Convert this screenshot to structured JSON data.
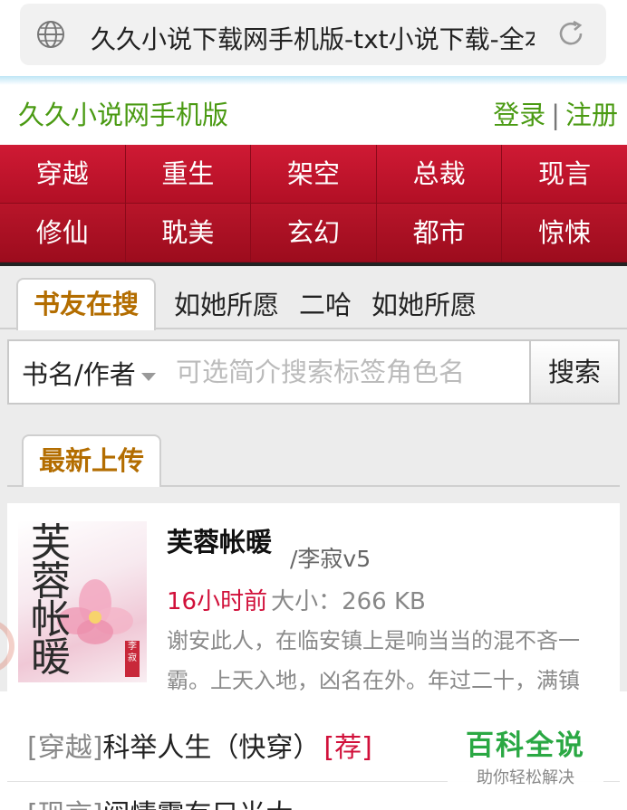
{
  "browser": {
    "url_title": "久久小说下载网手机版-txt小说下载-全本",
    "globe_icon": "globe-icon",
    "reload_icon": "reload-icon"
  },
  "header": {
    "site_title": "久久小说网手机版",
    "login": "登录",
    "separator": "|",
    "register": "注册"
  },
  "categories": {
    "row1": [
      "穿越",
      "重生",
      "架空",
      "总裁",
      "现言"
    ],
    "row2": [
      "修仙",
      "耽美",
      "玄幻",
      "都市",
      "惊悚"
    ]
  },
  "hot_search": {
    "tab_label": "书友在搜",
    "links": [
      "如她所愿",
      "二哈",
      "如她所愿"
    ]
  },
  "search": {
    "type_label": "书名/作者",
    "placeholder": "可选简介搜索标签角色名",
    "button_label": "搜索"
  },
  "latest": {
    "tab_label": "最新上传"
  },
  "featured_book": {
    "title": "芙蓉帐暖",
    "author": "/李寂v5",
    "time": "16小时前",
    "size": "大小：266 KB",
    "description": "谢安此人，在临安镇上是响当当的混不吝一霸。上天入地，凶名在外。年过二十，满镇",
    "cover_title": "芙蓉帐暖",
    "cover_seal": "李寂"
  },
  "book_list": [
    {
      "category": "[穿越]",
      "title": "科举人生（快穿）",
      "badge": "[荐]"
    },
    {
      "category": "[现言]",
      "title": "阀情霸有只光大",
      "badge": ""
    }
  ],
  "watermark": {
    "title": "百科全说",
    "subtitle": "助你轻松解决"
  }
}
